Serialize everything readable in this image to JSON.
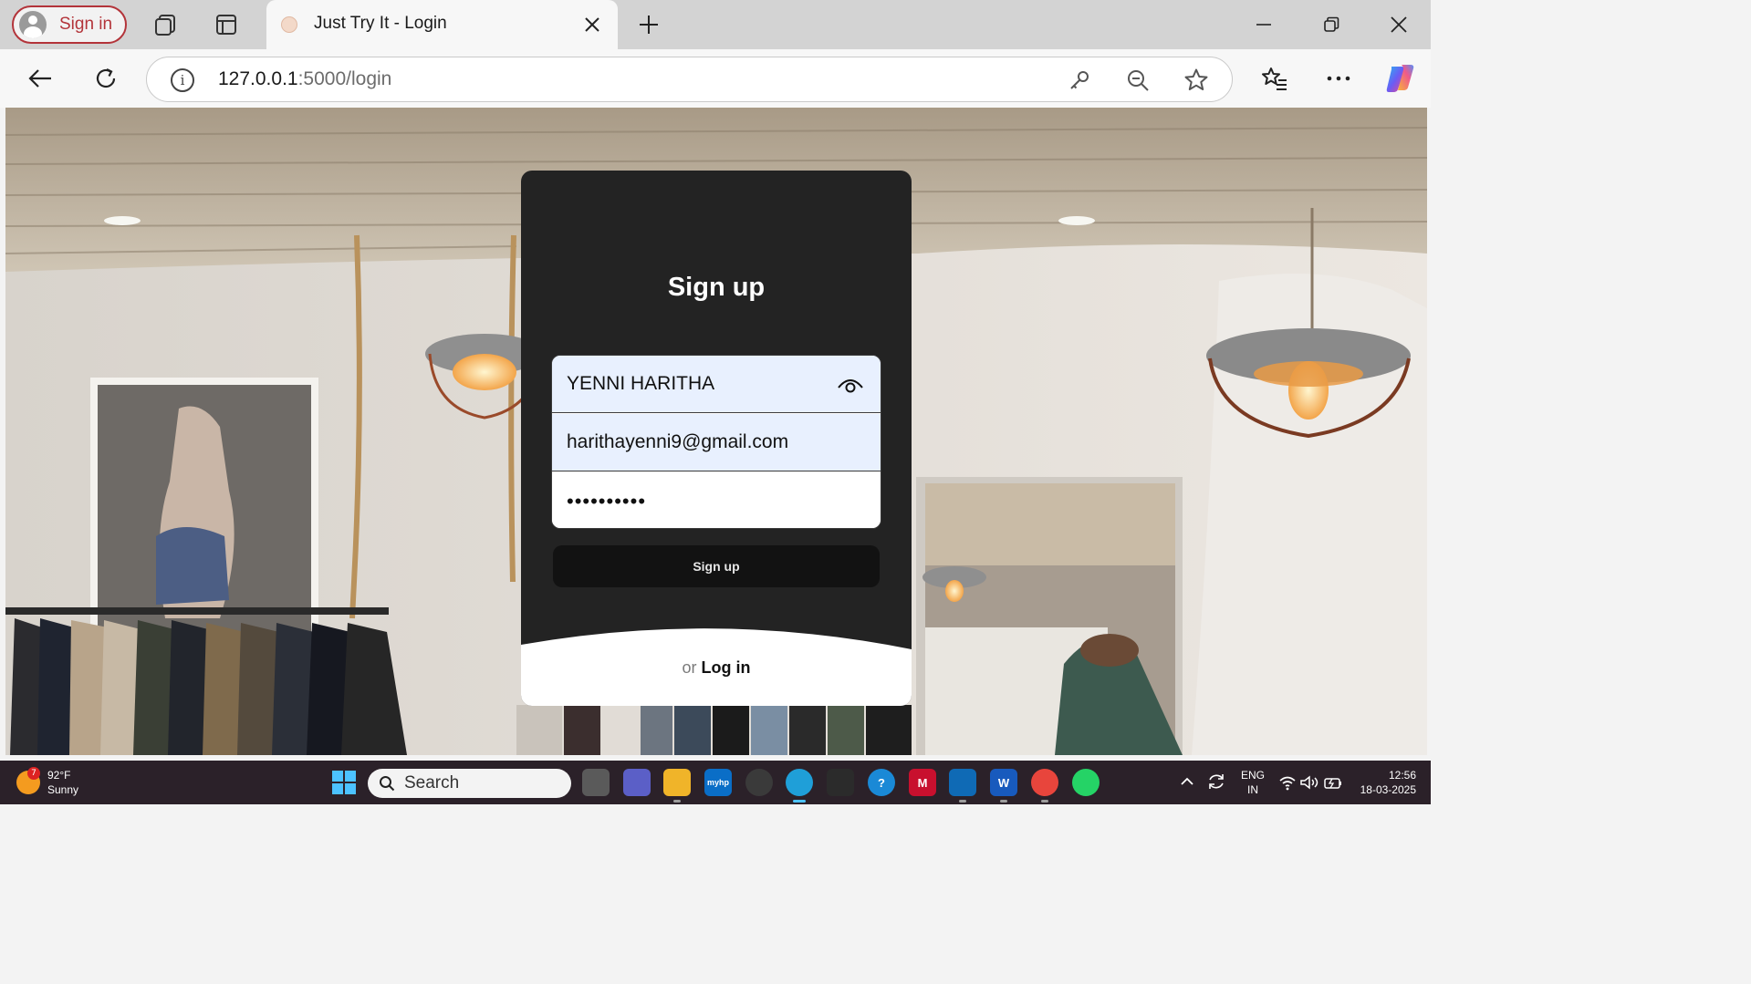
{
  "browser": {
    "profile_label": "Sign in",
    "tab_title": "Just Try It - Login",
    "url_host": "127.0.0.1",
    "url_rest": ":5000/login"
  },
  "page": {
    "heading": "Sign up",
    "form": {
      "name_value": "YENNI HARITHA",
      "email_value": "harithayenni9@gmail.com",
      "password_masked": "••••••••••"
    },
    "submit_label": "Sign up",
    "footer_or": "or",
    "footer_link": "Log in"
  },
  "taskbar": {
    "weather_badge": "7",
    "weather_temp": "92°F",
    "weather_condition": "Sunny",
    "search_label": "Search",
    "lang_line1": "ENG",
    "lang_line2": "IN",
    "time": "12:56",
    "date": "18-03-2025",
    "apps": [
      {
        "name": "task-view",
        "color": "#5a5a5a"
      },
      {
        "name": "teams",
        "color": "#5b5fc7"
      },
      {
        "name": "file-explorer",
        "color": "#f0b429"
      },
      {
        "name": "myhp",
        "color": "#0a6ec7"
      },
      {
        "name": "clock",
        "color": "#3a3a3a"
      },
      {
        "name": "edge",
        "color": "#1f9fd8"
      },
      {
        "name": "store",
        "color": "#2b2b2b"
      },
      {
        "name": "help",
        "color": "#1a89d6"
      },
      {
        "name": "mcafee",
        "color": "#c8102e"
      },
      {
        "name": "vscode",
        "color": "#0f6ab5"
      },
      {
        "name": "word",
        "color": "#185abd"
      },
      {
        "name": "chrome",
        "color": "#e8453c"
      },
      {
        "name": "whatsapp",
        "color": "#25d366"
      }
    ]
  },
  "colors": {
    "card_bg": "#232323",
    "autofill_bg": "#e8f0fe",
    "profile_accent": "#b3343a",
    "taskbar_bg": "#2b2129"
  }
}
